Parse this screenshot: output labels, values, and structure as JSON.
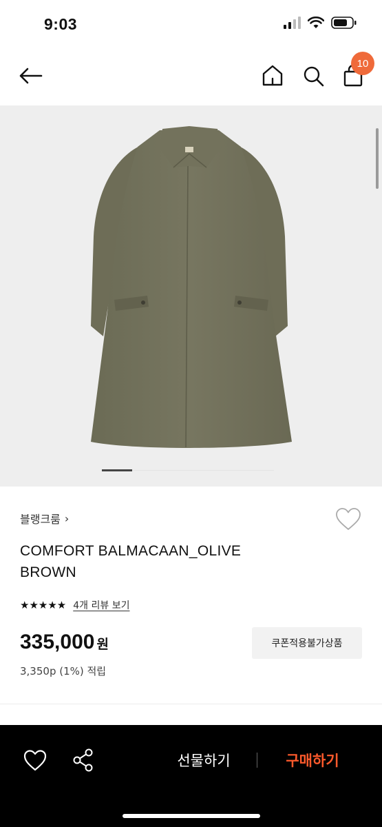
{
  "status_bar": {
    "time": "9:03"
  },
  "nav": {
    "cart_count": "10",
    "badge_color": "#ef6a3a",
    "icons": [
      "back-arrow-icon",
      "home-icon",
      "search-icon",
      "shopping-bag-icon"
    ]
  },
  "gallery": {
    "image": "olive-brown-balmacaan-coat",
    "page_index": 1
  },
  "product": {
    "brand": "블랭크룸",
    "brand_chevron": "›",
    "title": "COMFORT BALMACAAN_OLIVE BROWN",
    "stars": "★★★★★",
    "review_link": "4개 리뷰 보기",
    "price": "335,000",
    "currency": "원",
    "points": "3,350p (1%) 적립",
    "coupon_tag": "쿠폰적용불가상품"
  },
  "bottom_bar": {
    "gift_label": "선물하기",
    "buy_label": "구매하기",
    "buy_color": "#ff5a2c",
    "icons": [
      "heart-icon",
      "share-icon"
    ]
  }
}
